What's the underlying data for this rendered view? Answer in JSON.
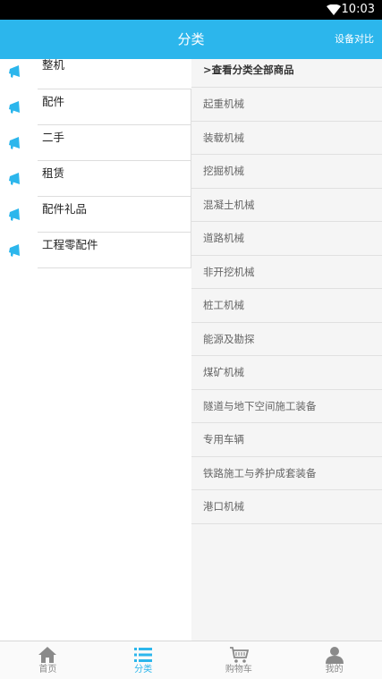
{
  "status_bar": {
    "time": "10:03",
    "wifi_icon": "wifi-icon"
  },
  "header": {
    "title": "分类",
    "compare_label": "设备对比"
  },
  "categories": [
    {
      "label": "整机",
      "icon": "megaphone-icon"
    },
    {
      "label": "配件",
      "icon": "megaphone-icon"
    },
    {
      "label": "二手",
      "icon": "megaphone-icon"
    },
    {
      "label": "租赁",
      "icon": "megaphone-icon"
    },
    {
      "label": "配件礼品",
      "icon": "megaphone-icon"
    },
    {
      "label": "工程零配件",
      "icon": "megaphone-icon"
    }
  ],
  "subcategories": [
    ">查看分类全部商品",
    "起重机械",
    "装载机械",
    "挖掘机械",
    "混凝土机械",
    "道路机械",
    "非开挖机械",
    "桩工机械",
    "能源及勘探",
    "煤矿机械",
    "隧道与地下空间施工装备",
    "专用车辆",
    "铁路施工与养护成套装备",
    "港口机械"
  ],
  "tabs": [
    {
      "label": "首页",
      "icon": "home-icon",
      "active": false
    },
    {
      "label": "分类",
      "icon": "list-icon",
      "active": true
    },
    {
      "label": "购物车",
      "icon": "cart-icon",
      "active": false
    },
    {
      "label": "我的",
      "icon": "user-icon",
      "active": false
    }
  ],
  "colors": {
    "accent": "#2cb6ec",
    "status_bar": "#000000",
    "right_pane_bg": "#f5f5f5"
  }
}
